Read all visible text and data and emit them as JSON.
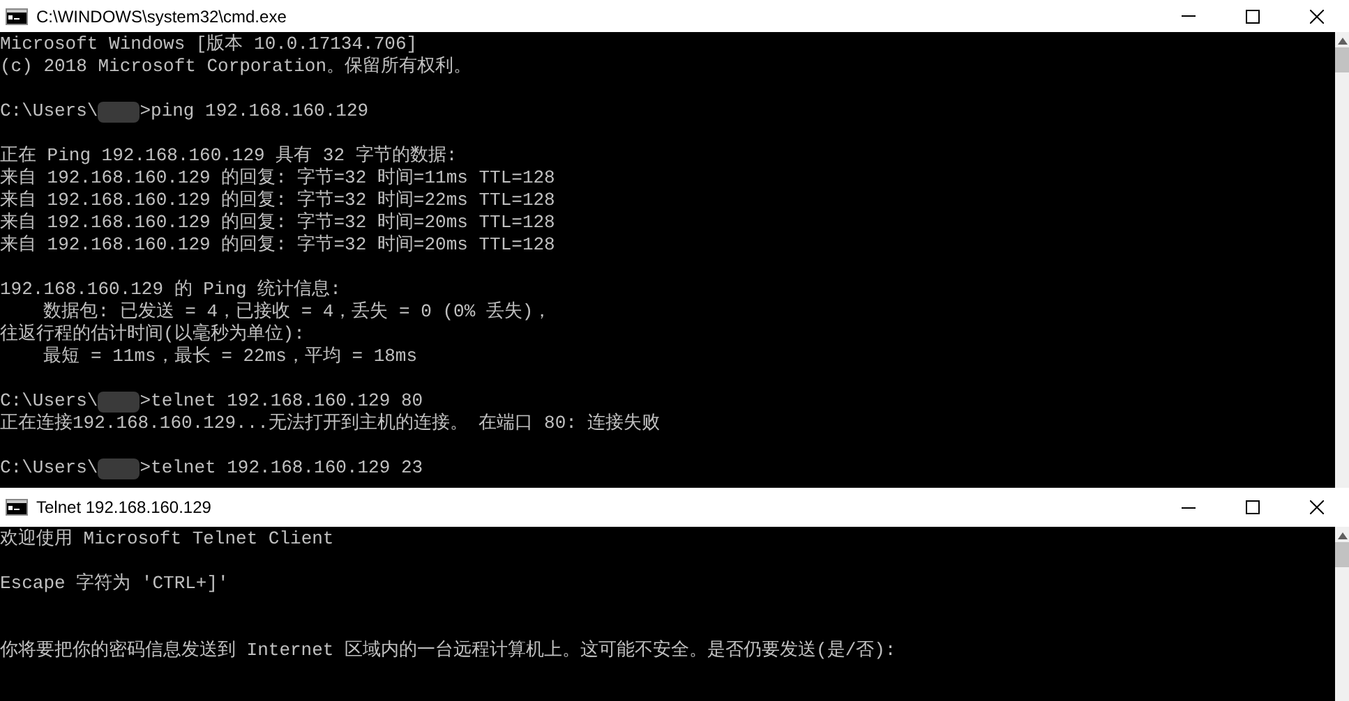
{
  "windows": [
    {
      "title": "C:\\WINDOWS\\system32\\cmd.exe",
      "lines": [
        {
          "kind": "text",
          "text": "Microsoft Windows [版本 10.0.17134.706]"
        },
        {
          "kind": "text",
          "text": "(c) 2018 Microsoft Corporation。保留所有权利。"
        },
        {
          "kind": "blank"
        },
        {
          "kind": "prompt",
          "before": "C:\\Users\\",
          "after": ">ping 192.168.160.129"
        },
        {
          "kind": "blank"
        },
        {
          "kind": "text",
          "text": "正在 Ping 192.168.160.129 具有 32 字节的数据:"
        },
        {
          "kind": "text",
          "text": "来自 192.168.160.129 的回复: 字节=32 时间=11ms TTL=128"
        },
        {
          "kind": "text",
          "text": "来自 192.168.160.129 的回复: 字节=32 时间=22ms TTL=128"
        },
        {
          "kind": "text",
          "text": "来自 192.168.160.129 的回复: 字节=32 时间=20ms TTL=128"
        },
        {
          "kind": "text",
          "text": "来自 192.168.160.129 的回复: 字节=32 时间=20ms TTL=128"
        },
        {
          "kind": "blank"
        },
        {
          "kind": "text",
          "text": "192.168.160.129 的 Ping 统计信息:"
        },
        {
          "kind": "text",
          "text": "    数据包: 已发送 = 4，已接收 = 4，丢失 = 0 (0% 丢失)，"
        },
        {
          "kind": "text",
          "text": "往返行程的估计时间(以毫秒为单位):"
        },
        {
          "kind": "text",
          "text": "    最短 = 11ms，最长 = 22ms，平均 = 18ms"
        },
        {
          "kind": "blank"
        },
        {
          "kind": "prompt",
          "before": "C:\\Users\\",
          "after": ">telnet 192.168.160.129 80"
        },
        {
          "kind": "text",
          "text": "正在连接192.168.160.129...无法打开到主机的连接。 在端口 80: 连接失败"
        },
        {
          "kind": "blank"
        },
        {
          "kind": "prompt",
          "before": "C:\\Users\\",
          "after": ">telnet 192.168.160.129 23"
        }
      ]
    },
    {
      "title": "Telnet 192.168.160.129",
      "lines": [
        {
          "kind": "text",
          "text": "欢迎使用 Microsoft Telnet Client"
        },
        {
          "kind": "blank"
        },
        {
          "kind": "text",
          "text": "Escape 字符为 'CTRL+]'"
        },
        {
          "kind": "blank"
        },
        {
          "kind": "blank"
        },
        {
          "kind": "text",
          "text": "你将要把你的密码信息发送到 Internet 区域内的一台远程计算机上。这可能不安全。是否仍要发送(是/否):"
        }
      ]
    }
  ]
}
